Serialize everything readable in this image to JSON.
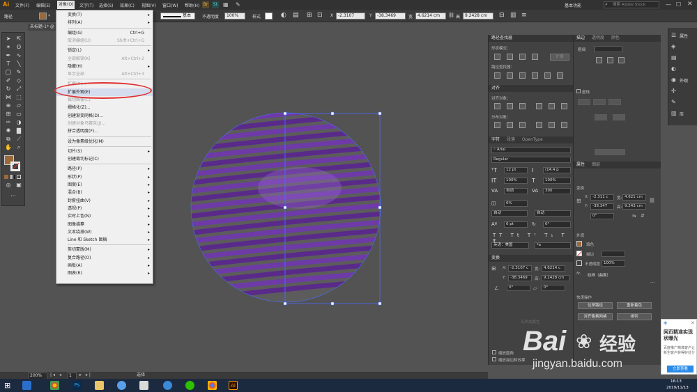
{
  "menubar": {
    "logo": "Ai",
    "items": [
      "文件(F)",
      "编辑(E)",
      "对象(O)",
      "文字(T)",
      "选择(S)",
      "效果(C)",
      "视图(V)",
      "窗口(W)",
      "帮助(H)"
    ],
    "workspace": "基本功能",
    "search_placeholder": "搜索 Adobe Stock"
  },
  "ctrlbar": {
    "object_type": "路径",
    "stroke_style": "基本",
    "opacity_label": "不透明度",
    "opacity_value": "100%",
    "style_label": "样式",
    "x_label": "X",
    "x_value": "-2.3107",
    "y_label": "Y",
    "y_value": "-38.3469",
    "w_label": "宽",
    "w_value": "4.6214 cm",
    "h_label": "高",
    "h_value": "9.2428 cm"
  },
  "document": {
    "tab_title": "未标题-1* @"
  },
  "dropdown": {
    "items": [
      {
        "label": "变换(T)",
        "shortcut": "",
        "submenu": true,
        "disabled": false
      },
      {
        "label": "排列(A)",
        "shortcut": "",
        "submenu": true,
        "disabled": false
      },
      {
        "label": "编组(G)",
        "shortcut": "Ctrl+G",
        "submenu": false,
        "disabled": false
      },
      {
        "label": "取消编组(U)",
        "shortcut": "Shift+Ctrl+G",
        "submenu": false,
        "disabled": true
      },
      {
        "label": "锁定(L)",
        "shortcut": "",
        "submenu": true,
        "disabled": false
      },
      {
        "label": "全部解锁(K)",
        "shortcut": "Alt+Ctrl+2",
        "submenu": false,
        "disabled": true
      },
      {
        "label": "隐藏(H)",
        "shortcut": "",
        "submenu": true,
        "disabled": false
      },
      {
        "label": "显示全部",
        "shortcut": "Alt+Ctrl+3",
        "submenu": false,
        "disabled": true
      },
      {
        "label": "扩展(X)...",
        "shortcut": "",
        "submenu": false,
        "disabled": true
      },
      {
        "label": "扩展外观(E)",
        "shortcut": "",
        "submenu": false,
        "disabled": false,
        "highlighted": true
      },
      {
        "label": "裁切图像(C)",
        "shortcut": "",
        "submenu": false,
        "disabled": true
      },
      {
        "label": "栅格化(Z)...",
        "shortcut": "",
        "submenu": false,
        "disabled": false
      },
      {
        "label": "创建渐变网格(D)...",
        "shortcut": "",
        "submenu": false,
        "disabled": false
      },
      {
        "label": "创建对象马赛克(J)...",
        "shortcut": "",
        "submenu": false,
        "disabled": true
      },
      {
        "label": "拼合透明度(F)...",
        "shortcut": "",
        "submenu": false,
        "disabled": false
      },
      {
        "label": "设为像素级优化(M)",
        "shortcut": "",
        "submenu": false,
        "disabled": false
      },
      {
        "label": "切片(S)",
        "shortcut": "",
        "submenu": true,
        "disabled": false
      },
      {
        "label": "创建裁切标记(C)",
        "shortcut": "",
        "submenu": false,
        "disabled": false
      },
      {
        "label": "路径(P)",
        "shortcut": "",
        "submenu": true,
        "disabled": false
      },
      {
        "label": "形状(P)",
        "shortcut": "",
        "submenu": true,
        "disabled": false
      },
      {
        "label": "图案(E)",
        "shortcut": "",
        "submenu": true,
        "disabled": false
      },
      {
        "label": "混合(B)",
        "shortcut": "",
        "submenu": true,
        "disabled": false
      },
      {
        "label": "封套扭曲(V)",
        "shortcut": "",
        "submenu": true,
        "disabled": false
      },
      {
        "label": "透视(P)",
        "shortcut": "",
        "submenu": true,
        "disabled": false
      },
      {
        "label": "实时上色(N)",
        "shortcut": "",
        "submenu": true,
        "disabled": false
      },
      {
        "label": "图像描摹",
        "shortcut": "",
        "submenu": true,
        "disabled": false
      },
      {
        "label": "文本绕排(W)",
        "shortcut": "",
        "submenu": true,
        "disabled": false
      },
      {
        "label": "Line 和 Sketch 图稿",
        "shortcut": "",
        "submenu": true,
        "disabled": false
      },
      {
        "label": "剪切蒙版(M)",
        "shortcut": "",
        "submenu": true,
        "disabled": false
      },
      {
        "label": "复合路径(O)",
        "shortcut": "",
        "submenu": true,
        "disabled": false
      },
      {
        "label": "画板(A)",
        "shortcut": "",
        "submenu": true,
        "disabled": false
      },
      {
        "label": "图表(R)",
        "shortcut": "",
        "submenu": true,
        "disabled": false
      }
    ]
  },
  "pathfinder": {
    "title": "路径查找器",
    "shape_modes": "形状模式：",
    "pathfinders": "路径查找器：",
    "expand": "扩展"
  },
  "align": {
    "title": "对齐",
    "align_objects": "对齐对象：",
    "distribute_objects": "分布对象："
  },
  "character": {
    "tabs": [
      "字符",
      "段落",
      "OpenType"
    ],
    "font": "Arial",
    "style": "Regular",
    "size": "12 pt",
    "leading": "(14.4 p",
    "v_scale": "100%",
    "h_scale": "100%",
    "kerning": "自动",
    "tracking": "300",
    "tsume": "0%",
    "aki_left": "自动",
    "aki_right": "自动",
    "baseline": "0 pt",
    "rotation": "0°",
    "language": "英语：美国",
    "aa": "ªa"
  },
  "transform_mid": {
    "title": "变换",
    "x": "-2.3107 c",
    "y": "-38.3469",
    "w": "4.6214 c",
    "h": "9.2428 cm",
    "angle": "0°",
    "shear": "0°"
  },
  "bottom_options": [
    "缩放圆角",
    "缩放描边和效果"
  ],
  "right_panel": {
    "tabs": [
      "描边",
      "透明度",
      "颜色"
    ],
    "weight_label": "粗细",
    "dashed": "虚线",
    "props_tabs": [
      "属性",
      "图层"
    ],
    "transform_label": "变换",
    "x": "-2.311 c",
    "y": "-38.347",
    "w": "4.621 cm",
    "h": "9.243 cm",
    "angle": "0°",
    "appearance_label": "外观",
    "fill_label": "填色",
    "stroke_label": "描边",
    "opacity_label": "不透明度",
    "opacity_value": "100%",
    "fx_label": "纹样（曲面）",
    "quick_actions": "快速操作",
    "buttons": [
      "位移路径",
      "重新着色",
      "对齐像素网格",
      "排列"
    ]
  },
  "dock": {
    "items": [
      "属性",
      "外观",
      "库"
    ]
  },
  "status": {
    "zoom": "200%",
    "artboard": "1",
    "tool": "选择"
  },
  "taskbar": {
    "time": "16:13",
    "date": "2019/11/13"
  },
  "ad": {
    "title": "网页精准实现状曝光",
    "body": "百度推广精准客户让新生客户获得好处分",
    "button": "立即查看"
  },
  "watermark": {
    "brand": "Bai",
    "brand2": "经验",
    "url": "jingyan.baidu.com"
  },
  "colors": {
    "sphere_purple": "#5a2a8a",
    "sphere_light": "#9a6ad0",
    "selection_blue": "#4a6cff",
    "annotation_red": "#e03030",
    "fill_swatch": "#9c6a3a"
  }
}
